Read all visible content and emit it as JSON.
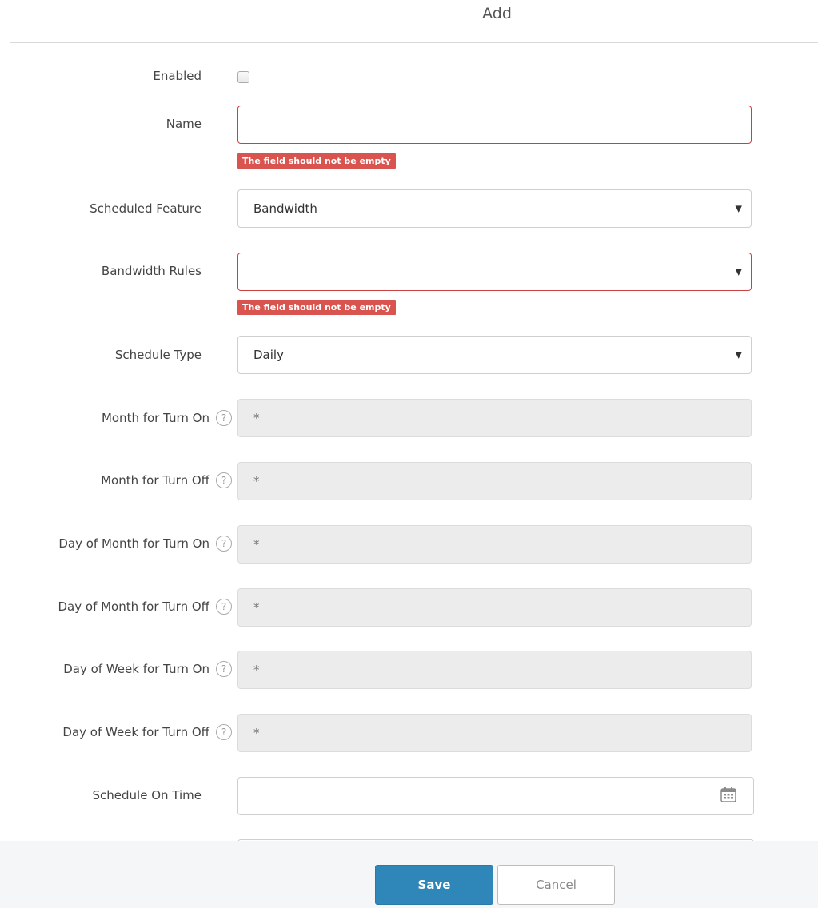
{
  "header": {
    "title": "Add"
  },
  "form": {
    "enabled_label": "Enabled",
    "name_label": "Name",
    "name_value": "",
    "name_error": "The field should not be empty",
    "scheduled_feature_label": "Scheduled Feature",
    "scheduled_feature_value": "Bandwidth",
    "bandwidth_rules_label": "Bandwidth Rules",
    "bandwidth_rules_value": "",
    "bandwidth_rules_error": "The field should not be empty",
    "schedule_type_label": "Schedule Type",
    "schedule_type_value": "Daily",
    "month_on_label": "Month for Turn On",
    "month_on_value": "*",
    "month_off_label": "Month for Turn Off",
    "month_off_value": "*",
    "dom_on_label": "Day of Month for Turn On",
    "dom_on_value": "*",
    "dom_off_label": "Day of Month for Turn Off",
    "dom_off_value": "*",
    "dow_on_label": "Day of Week for Turn On",
    "dow_on_value": "*",
    "dow_off_label": "Day of Week for Turn Off",
    "dow_off_value": "*",
    "schedule_on_time_label": "Schedule On Time",
    "schedule_on_time_value": "",
    "help_glyph": "?",
    "dropdown_glyph": "▼"
  },
  "footer": {
    "save_label": "Save",
    "cancel_label": "Cancel"
  },
  "colors": {
    "primary": "#2f86b9",
    "error": "#d9534f",
    "disabled_bg": "#ececec"
  },
  "icons": [
    "help-icon",
    "chevron-down-icon",
    "calendar-icon",
    "checkbox"
  ]
}
